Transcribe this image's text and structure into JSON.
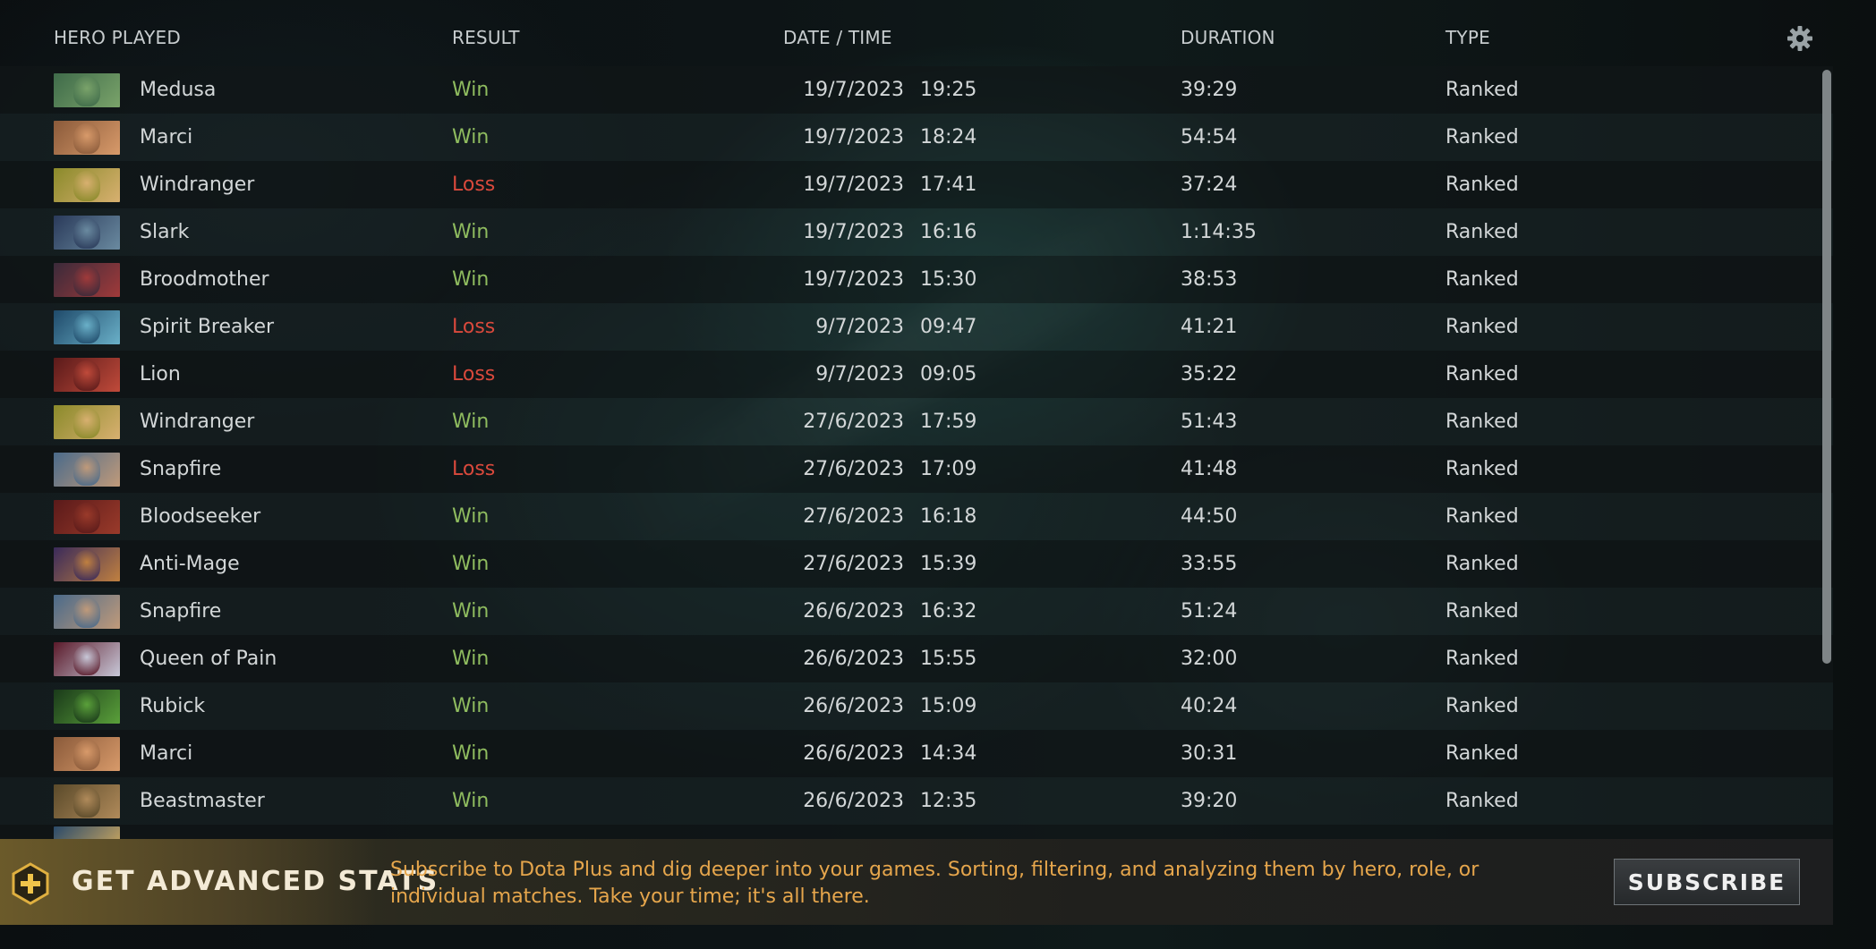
{
  "columns": {
    "hero": "HERO PLAYED",
    "result": "RESULT",
    "datetime": "DATE / TIME",
    "duration": "DURATION",
    "type": "TYPE"
  },
  "settings_icon": "gear-icon",
  "matches": [
    {
      "hero": "Medusa",
      "result": "Win",
      "date": "19/7/2023",
      "time": "19:25",
      "duration": "39:29",
      "type": "Ranked",
      "portrait": [
        "#3f6b4a",
        "#7aa36a"
      ]
    },
    {
      "hero": "Marci",
      "result": "Win",
      "date": "19/7/2023",
      "time": "18:24",
      "duration": "54:54",
      "type": "Ranked",
      "portrait": [
        "#8a5a3a",
        "#d89a6a"
      ]
    },
    {
      "hero": "Windranger",
      "result": "Loss",
      "date": "19/7/2023",
      "time": "17:41",
      "duration": "37:24",
      "type": "Ranked",
      "portrait": [
        "#8a8a2a",
        "#d8b070"
      ]
    },
    {
      "hero": "Slark",
      "result": "Win",
      "date": "19/7/2023",
      "time": "16:16",
      "duration": "1:14:35",
      "type": "Ranked",
      "portrait": [
        "#2a3a5a",
        "#6a8aa0"
      ]
    },
    {
      "hero": "Broodmother",
      "result": "Win",
      "date": "19/7/2023",
      "time": "15:30",
      "duration": "38:53",
      "type": "Ranked",
      "portrait": [
        "#3a2a3a",
        "#a03a3a"
      ]
    },
    {
      "hero": "Spirit Breaker",
      "result": "Loss",
      "date": "9/7/2023",
      "time": "09:47",
      "duration": "41:21",
      "type": "Ranked",
      "portrait": [
        "#1f4a6a",
        "#6ab0c8"
      ]
    },
    {
      "hero": "Lion",
      "result": "Loss",
      "date": "9/7/2023",
      "time": "09:05",
      "duration": "35:22",
      "type": "Ranked",
      "portrait": [
        "#5a1a1a",
        "#c04a3a"
      ]
    },
    {
      "hero": "Windranger",
      "result": "Win",
      "date": "27/6/2023",
      "time": "17:59",
      "duration": "51:43",
      "type": "Ranked",
      "portrait": [
        "#8a8a2a",
        "#d8b070"
      ]
    },
    {
      "hero": "Snapfire",
      "result": "Loss",
      "date": "27/6/2023",
      "time": "17:09",
      "duration": "41:48",
      "type": "Ranked",
      "portrait": [
        "#4a6a8a",
        "#c09a7a"
      ]
    },
    {
      "hero": "Bloodseeker",
      "result": "Win",
      "date": "27/6/2023",
      "time": "16:18",
      "duration": "44:50",
      "type": "Ranked",
      "portrait": [
        "#5a1a1a",
        "#9a3a2a"
      ]
    },
    {
      "hero": "Anti-Mage",
      "result": "Win",
      "date": "27/6/2023",
      "time": "15:39",
      "duration": "33:55",
      "type": "Ranked",
      "portrait": [
        "#3a2a5a",
        "#c08040"
      ]
    },
    {
      "hero": "Snapfire",
      "result": "Win",
      "date": "26/6/2023",
      "time": "16:32",
      "duration": "51:24",
      "type": "Ranked",
      "portrait": [
        "#4a6a8a",
        "#c09a7a"
      ]
    },
    {
      "hero": "Queen of Pain",
      "result": "Win",
      "date": "26/6/2023",
      "time": "15:55",
      "duration": "32:00",
      "type": "Ranked",
      "portrait": [
        "#5a1a2a",
        "#c8c8d8"
      ]
    },
    {
      "hero": "Rubick",
      "result": "Win",
      "date": "26/6/2023",
      "time": "15:09",
      "duration": "40:24",
      "type": "Ranked",
      "portrait": [
        "#1a3a1a",
        "#5aa03a"
      ]
    },
    {
      "hero": "Marci",
      "result": "Win",
      "date": "26/6/2023",
      "time": "14:34",
      "duration": "30:31",
      "type": "Ranked",
      "portrait": [
        "#8a5a3a",
        "#d89a6a"
      ]
    },
    {
      "hero": "Beastmaster",
      "result": "Win",
      "date": "26/6/2023",
      "time": "12:35",
      "duration": "39:20",
      "type": "Ranked",
      "portrait": [
        "#5a4a2a",
        "#b08a5a"
      ]
    }
  ],
  "colors": {
    "win": "#8fbc5f",
    "loss": "#d9493c",
    "banner_text": "#e6a64c"
  },
  "banner": {
    "icon": "plus-icon",
    "title": "GET ADVANCED STATS",
    "text": "Subscribe to Dota Plus and dig deeper into your games. Sorting, filtering, and analyzing them by hero, role, or individual matches. Take your time; it's all there.",
    "button": "SUBSCRIBE"
  }
}
